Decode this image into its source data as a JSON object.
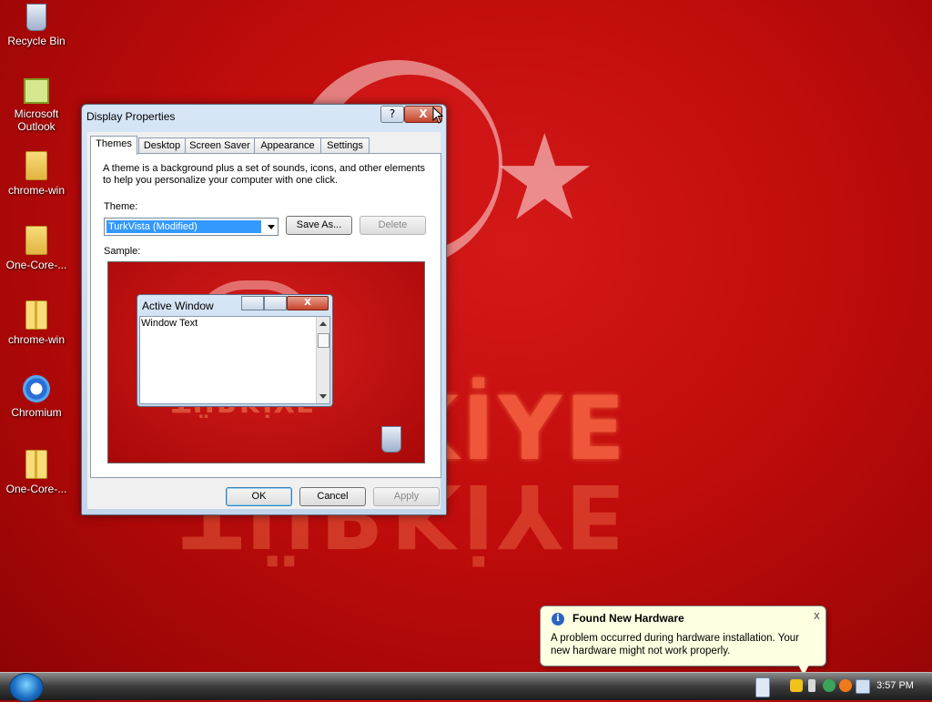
{
  "desktop": {
    "icons": [
      {
        "label": "Recycle Bin",
        "icon": "recycle-bin-icon"
      },
      {
        "label": "Microsoft Outlook",
        "icon": "outlook-icon"
      },
      {
        "label": "chrome-win",
        "icon": "folder-icon"
      },
      {
        "label": "One-Core-...",
        "icon": "folder-icon"
      },
      {
        "label": "chrome-win",
        "icon": "zip-folder-icon"
      },
      {
        "label": "Chromium",
        "icon": "chromium-icon"
      },
      {
        "label": "One-Core-...",
        "icon": "zip-folder-icon"
      }
    ],
    "wallpaper_text": "TÜRKİYE"
  },
  "dialog": {
    "title": "Display Properties",
    "help_label": "?",
    "close_label": "X",
    "tabs": [
      {
        "label": "Themes",
        "active": true
      },
      {
        "label": "Desktop"
      },
      {
        "label": "Screen Saver"
      },
      {
        "label": "Appearance"
      },
      {
        "label": "Settings"
      }
    ],
    "description": "A theme is a background plus a set of sounds, icons, and other elements to help you personalize your computer with one click.",
    "theme_label": "Theme:",
    "theme_value": "TurkVista (Modified)",
    "save_as_label": "Save As...",
    "delete_label": "Delete",
    "sample_label": "Sample:",
    "sample": {
      "window_title": "Active Window",
      "window_text": "Window Text"
    },
    "ok_label": "OK",
    "cancel_label": "Cancel",
    "apply_label": "Apply"
  },
  "balloon": {
    "title": "Found New Hardware",
    "message": "A problem occurred during hardware installation. Your new hardware might not work properly.",
    "close_label": "x"
  },
  "taskbar": {
    "clock": "3:57 PM"
  }
}
